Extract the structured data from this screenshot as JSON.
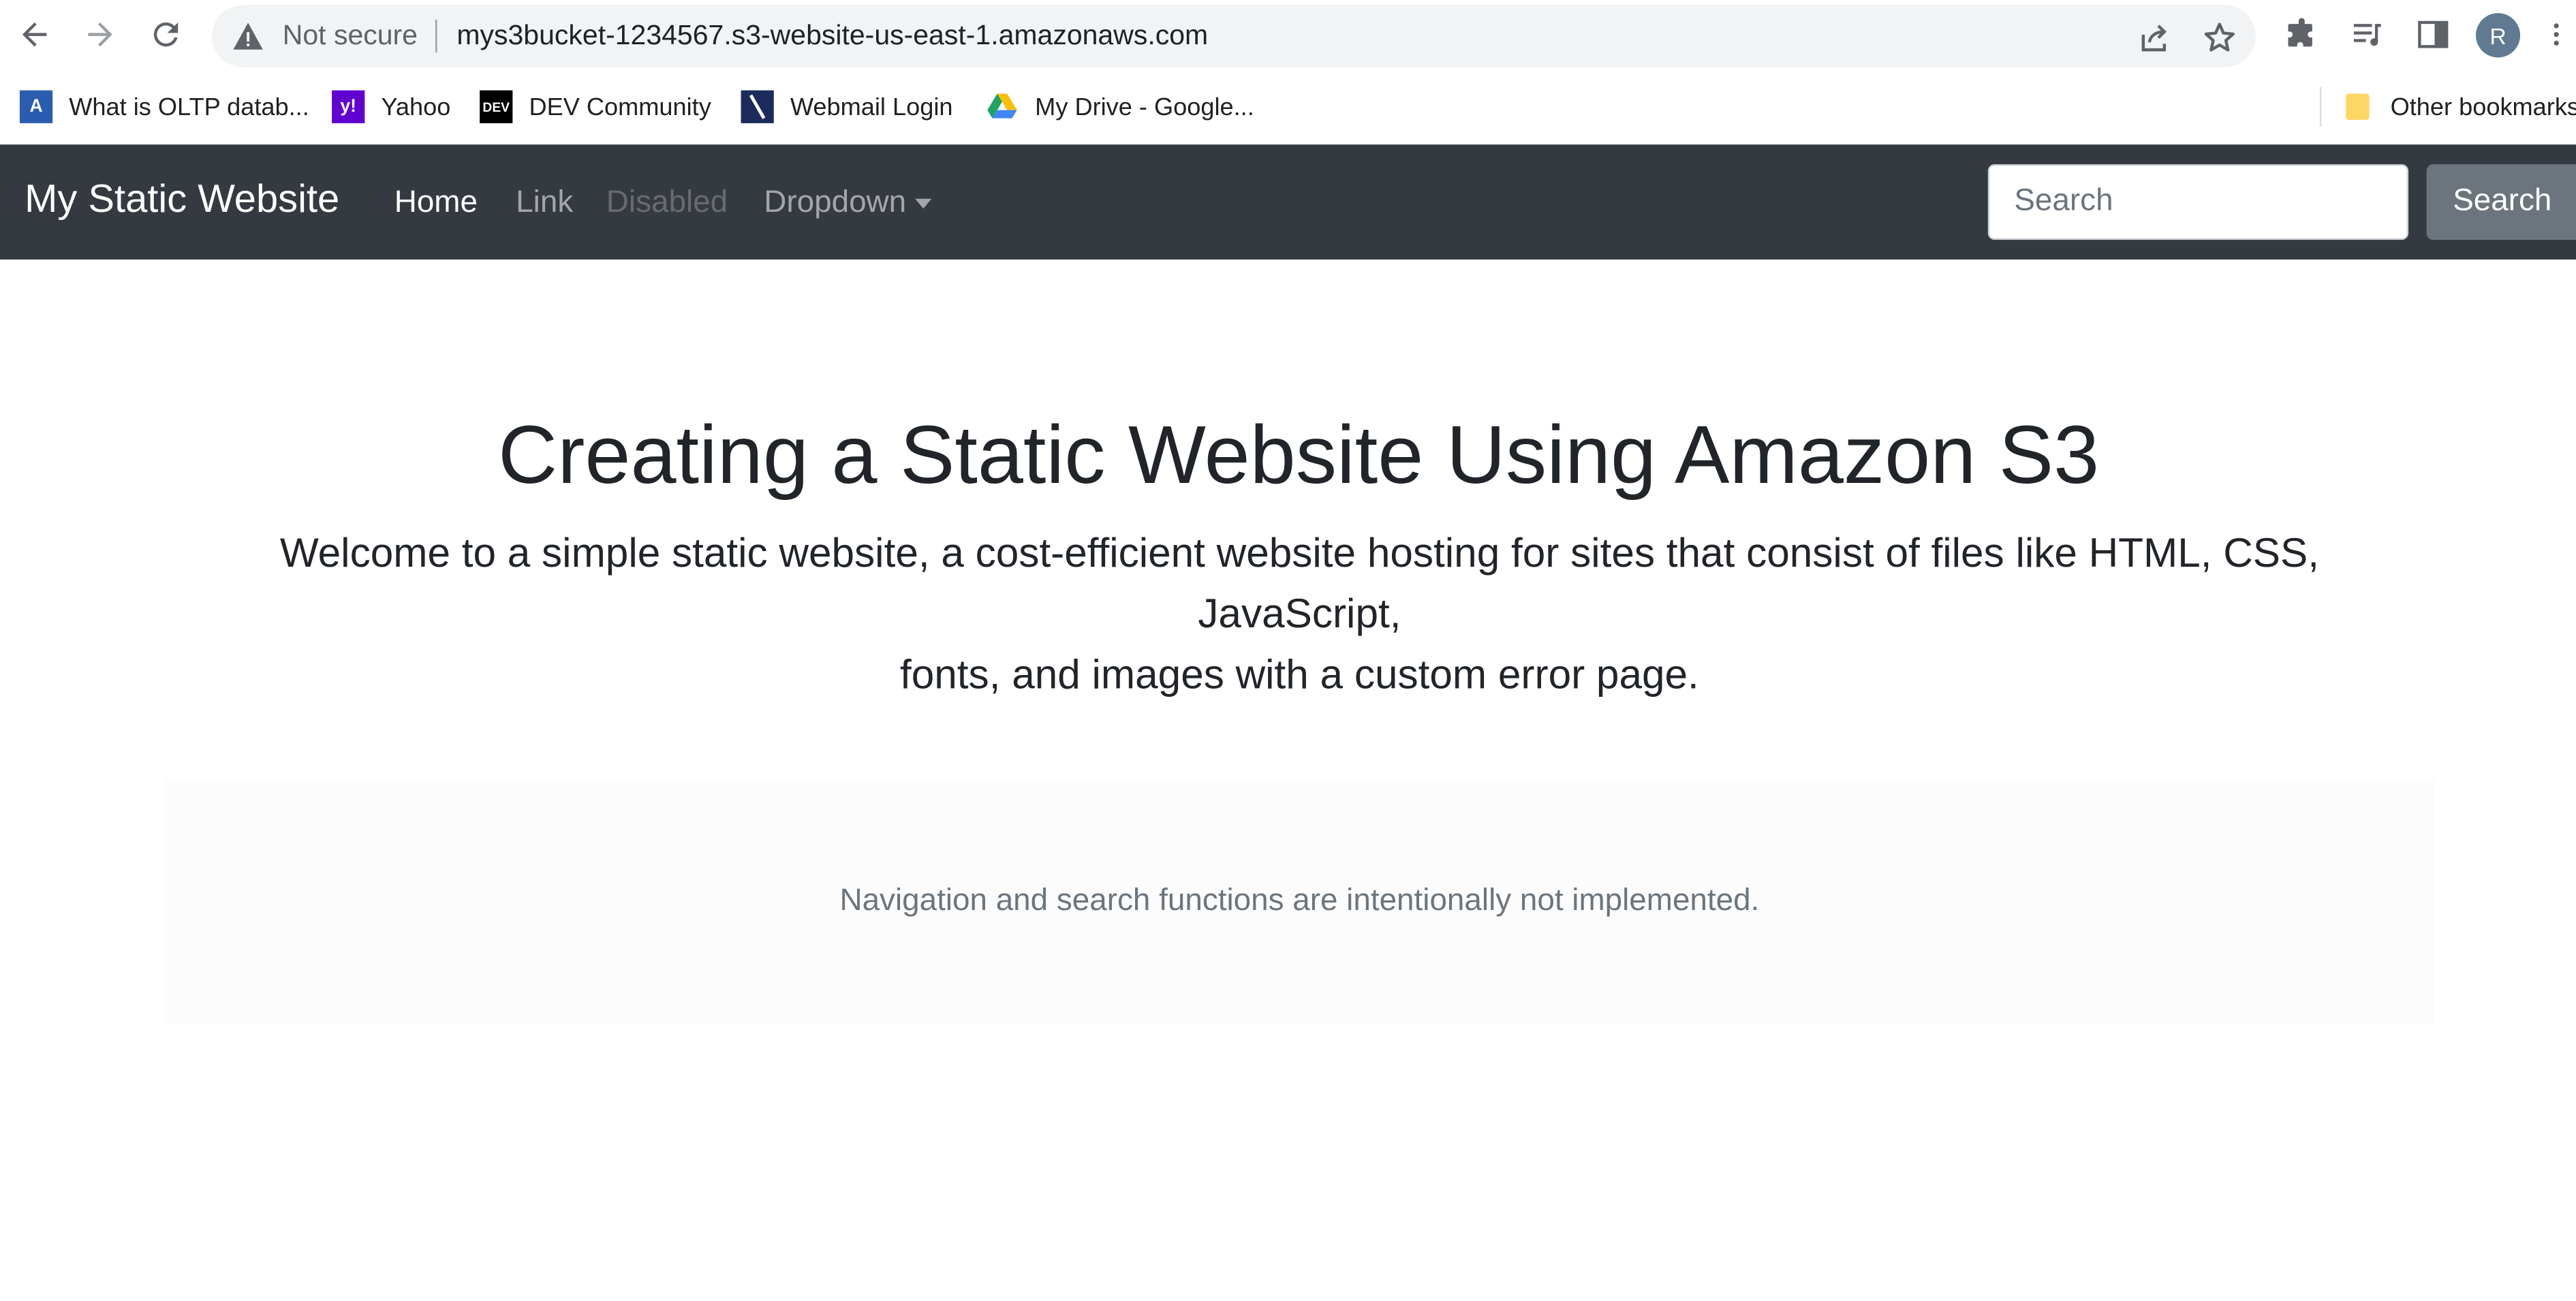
{
  "browser": {
    "security_label": "Not secure",
    "url": "mys3bucket-1234567.s3-website-us-east-1.amazonaws.com",
    "profile_initial": "R",
    "bookmarks": [
      {
        "label": "What is OLTP datab...",
        "icon": "a-icon"
      },
      {
        "label": "Yahoo",
        "icon": "yahoo-icon"
      },
      {
        "label": "DEV Community",
        "icon": "dev-icon"
      },
      {
        "label": "Webmail Login",
        "icon": "webmail-icon"
      },
      {
        "label": "My Drive - Google...",
        "icon": "google-drive-icon"
      }
    ],
    "other_bookmarks": "Other bookmarks"
  },
  "navbar": {
    "brand": "My Static Website",
    "links": [
      {
        "label": "Home",
        "state": "active"
      },
      {
        "label": "Link",
        "state": "normal"
      },
      {
        "label": "Disabled",
        "state": "disabled"
      },
      {
        "label": "Dropdown",
        "state": "dropdown"
      }
    ],
    "search_placeholder": "Search",
    "search_button": "Search",
    "background_color": "#343a40"
  },
  "hero": {
    "title": "Creating a Static Website Using Amazon S3",
    "lead_line1": "Welcome to a simple static website, a cost-efficient website hosting for sites that consist of files like HTML, CSS, JavaScript,",
    "lead_line2": "fonts, and images with a custom error page."
  },
  "notice": {
    "text": "Navigation and search functions are intentionally not implemented."
  }
}
